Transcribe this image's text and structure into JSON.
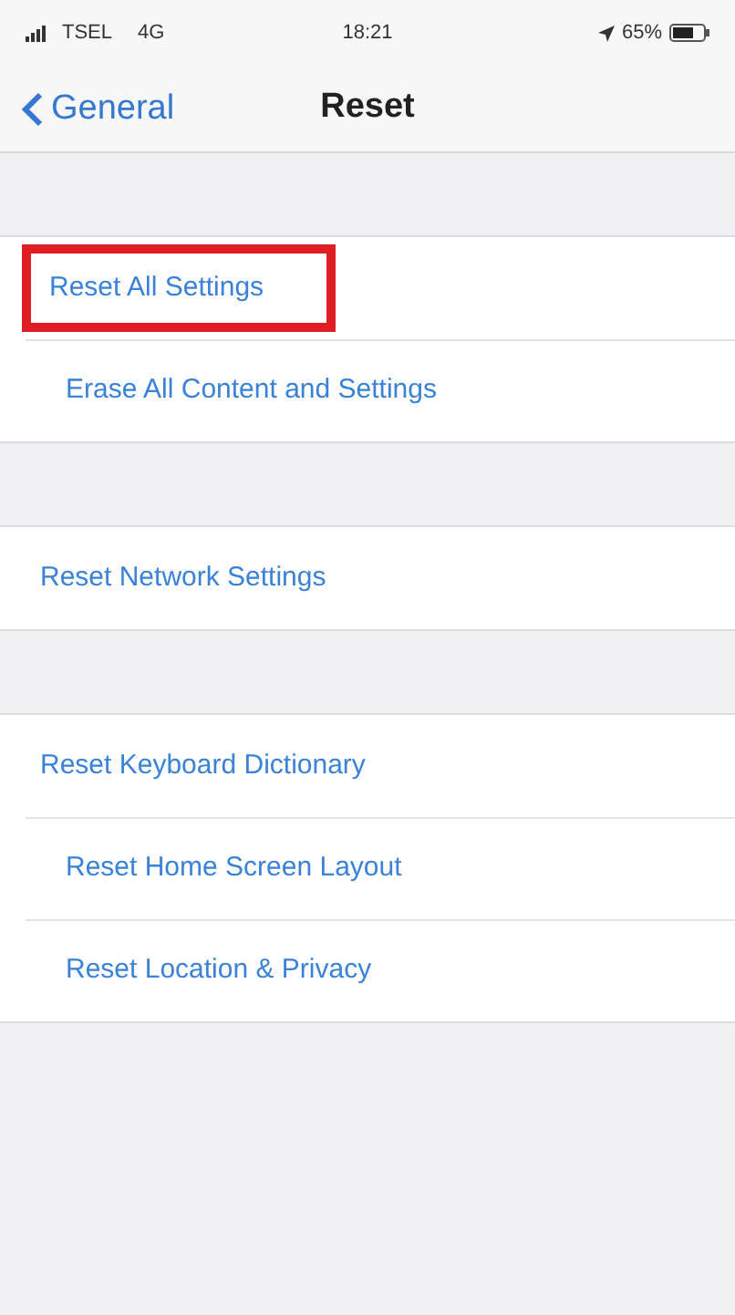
{
  "status_bar": {
    "carrier": "TSEL",
    "network": "4G",
    "time": "18:21",
    "battery": "65%"
  },
  "nav_bar": {
    "back": "General",
    "title": "Reset"
  },
  "groups": [
    {
      "items": [
        {
          "label": "Reset All Settings",
          "highlighted": true
        },
        {
          "label": "Erase All Content and Settings",
          "highlighted": false
        }
      ]
    },
    {
      "items": [
        {
          "label": "Reset Network Settings",
          "highlighted": false
        }
      ]
    },
    {
      "items": [
        {
          "label": "Reset Keyboard Dictionary",
          "highlighted": false
        },
        {
          "label": "Reset Home Screen Layout",
          "highlighted": false
        },
        {
          "label": "Reset Location & Privacy",
          "highlighted": false
        }
      ]
    }
  ]
}
